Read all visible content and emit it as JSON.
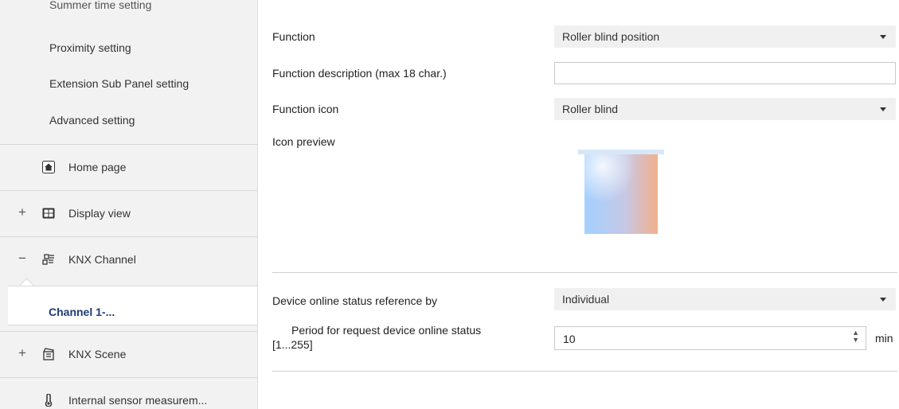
{
  "sidebar": {
    "cut_item": "Summer time setting",
    "sub_items": [
      "Proximity setting",
      "Extension Sub Panel setting",
      "Advanced setting"
    ],
    "nav": [
      {
        "sign": "",
        "icon": "home-icon",
        "label": "Home page"
      },
      {
        "sign": "+",
        "icon": "display-grid-icon",
        "label": "Display view"
      },
      {
        "sign": "−",
        "icon": "knx-channel-icon",
        "label": "KNX Channel"
      },
      {
        "sign": "+",
        "icon": "scene-icon",
        "label": "KNX Scene"
      },
      {
        "sign": "",
        "icon": "thermometer-icon",
        "label": "Internal sensor measurem..."
      }
    ],
    "channel_item": "Channel 1-..."
  },
  "main": {
    "function": {
      "label": "Function",
      "value": "Roller blind position"
    },
    "description": {
      "label": "Function description (max 18 char.)",
      "value": ""
    },
    "icon": {
      "label": "Function icon",
      "value": "Roller blind"
    },
    "preview": {
      "label": "Icon preview",
      "icon": "roller-blind-icon"
    },
    "online_ref": {
      "label": "Device online status reference by",
      "value": "Individual"
    },
    "period": {
      "label_line1": "Period for request device online status",
      "label_line2": "[1...255]",
      "value": "10",
      "unit": "min"
    }
  },
  "colors": {
    "accent": "#1f3a78",
    "sidebar_bg": "#f2f2f2",
    "combo_bg": "#f0f0f0"
  }
}
